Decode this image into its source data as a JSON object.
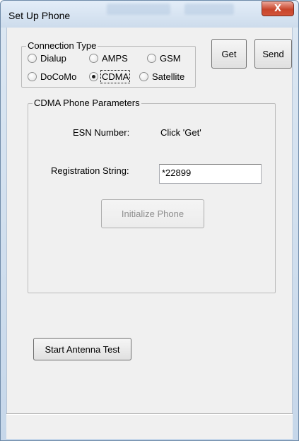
{
  "window": {
    "title": "Set Up Phone",
    "close_glyph": "X"
  },
  "connection_type": {
    "legend": "Connection Type",
    "options": [
      {
        "label": "Dialup",
        "selected": false
      },
      {
        "label": "AMPS",
        "selected": false
      },
      {
        "label": "GSM",
        "selected": false
      },
      {
        "label": "DoCoMo",
        "selected": false
      },
      {
        "label": "CDMA",
        "selected": true
      },
      {
        "label": "Satellite",
        "selected": false
      }
    ]
  },
  "buttons": {
    "get": "Get",
    "send": "Send",
    "initialize": "Initialize Phone",
    "antenna": "Start Antenna Test"
  },
  "cdma_params": {
    "legend": "CDMA Phone Parameters",
    "esn_label": "ESN Number:",
    "esn_value": "Click 'Get'",
    "registration_label": "Registration String:",
    "registration_value": "*22899"
  },
  "colors": {
    "accent": "#c8452b",
    "frame": "#c6d7ea",
    "client": "#f0f0f0"
  },
  "icons": {
    "close": "close-icon",
    "radio": "radio-icon"
  }
}
